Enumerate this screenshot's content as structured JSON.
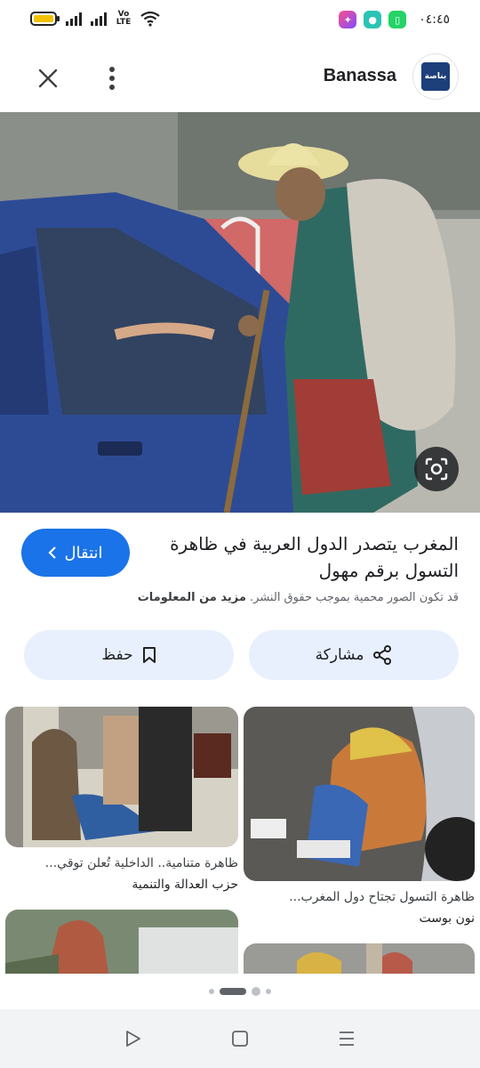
{
  "status_bar": {
    "time": "٠٤:٤٥",
    "network_label": "Vo LTE",
    "battery_level": 0.85
  },
  "header": {
    "source_name": "Banassa",
    "logo_text": "بناصة"
  },
  "main": {
    "title": "المغرب يتصدر الدول العربية في ظاهرة التسول برقم مهول",
    "visit_label": "انتقال",
    "copyright_text": "قد تكون الصور محمية بموجب حقوق النشر.",
    "learn_more_label": "مزيد من المعلومات",
    "share_label": "مشاركة",
    "save_label": "حفظ"
  },
  "related": [
    {
      "caption": "ظاهرة التسول تجتاح دول المغرب...",
      "source": "نون بوست"
    },
    {
      "caption": "ظاهرة متنامية.. الداخلية تُعلن توقي...",
      "source": "حزب العدالة والتنمية"
    }
  ],
  "colors": {
    "accent": "#1a73e8",
    "tonal_button": "#e8f0fe"
  }
}
